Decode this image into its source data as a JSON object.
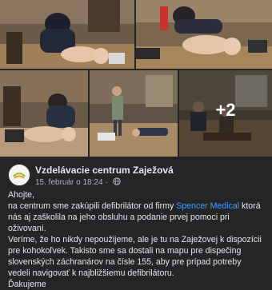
{
  "photos": {
    "more_count": "+2"
  },
  "post": {
    "page_name": "Vzdelávacie centrum Zaježová",
    "date": "15. február o 18:24",
    "separator": "·",
    "greeting": "Ahojte,",
    "p1_before": "na centrum sme zakúpili defibrilátor od firmy ",
    "p1_link": "Spencer Medical",
    "p1_after": " ktorá nás aj zaškolila na jeho obsluhu a podanie prvej pomoci pri oživovaní.",
    "p2": "Veríme, že ho nikdy nepoužijeme, ale je tu na Zaježovej k dispozícii pre kohokoľvek. Takisto sme sa dostali na mapu pre dispečing slovenských záchranárov na čísle 155, aby pre prípad potreby vedeli navigovať k najbližšiemu defibrilátoru.",
    "closing": "Ďakujeme"
  },
  "colors": {
    "background": "#242526",
    "link": "#4599ff",
    "text": "#e4e6eb",
    "meta": "#b0b3b8"
  },
  "icons": [
    "globe-icon",
    "avatar-logo"
  ]
}
